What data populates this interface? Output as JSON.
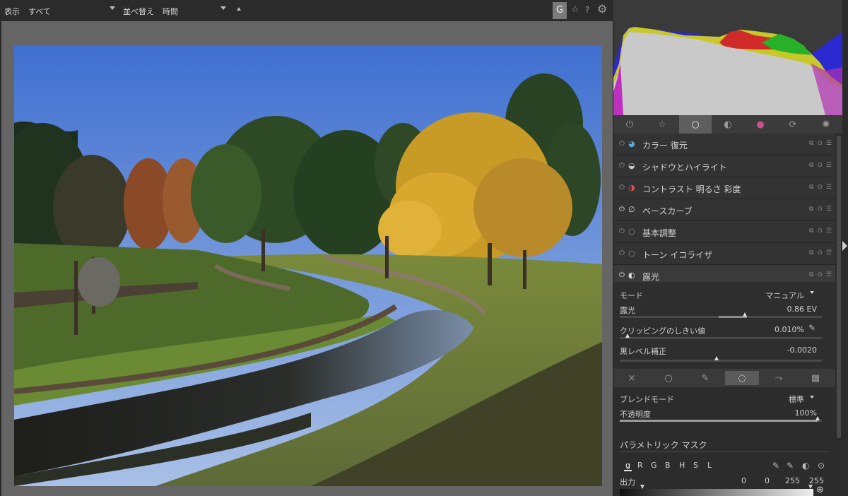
{
  "toolbar": {
    "view_label": "表示",
    "view_value": "すべて",
    "sort_label": "並べ替え",
    "sort_value": "時間",
    "grouping_btn": "G",
    "star_icon": "☆",
    "help_icon": "?",
    "gear_icon": "⚙"
  },
  "tabs": [
    {
      "name": "power",
      "glyph": "⏻"
    },
    {
      "name": "favorites",
      "glyph": "☆"
    },
    {
      "name": "basic",
      "glyph": "○"
    },
    {
      "name": "tone",
      "glyph": "◐"
    },
    {
      "name": "color",
      "glyph": "●"
    },
    {
      "name": "correct",
      "glyph": "⟳"
    },
    {
      "name": "effect",
      "glyph": "✺"
    }
  ],
  "modules": [
    {
      "label": "カラー 復元",
      "icon": "◕",
      "icon_color": "#58a8d8",
      "active": false
    },
    {
      "label": "シャドウとハイライト",
      "icon": "◒",
      "icon_color": "#c8c8c8",
      "active": false
    },
    {
      "label": "コントラスト 明るさ 彩度",
      "icon": "◑",
      "icon_color": "#e05050",
      "active": false
    },
    {
      "label": "ベースカーブ",
      "icon": "∅",
      "icon_color": "#d8d8d8",
      "active": true
    },
    {
      "label": "基本調整",
      "icon": "○",
      "icon_color": "#8a8a8a",
      "active": false
    },
    {
      "label": "トーン イコライザ",
      "icon": "○",
      "icon_color": "#8a8a8a",
      "active": false
    },
    {
      "label": "露光",
      "icon": "◐",
      "icon_color": "#e0e0e0",
      "active": true
    }
  ],
  "exposure": {
    "mode_label": "モード",
    "mode_value": "マニュアル",
    "exposure_label": "露光",
    "exposure_value": "0.86 EV",
    "exposure_level": 0.62,
    "clipping_label": "クリッピングのしきい値",
    "clipping_value": "0.010%",
    "black_label": "黒レベル補正",
    "black_value": "-0.0020",
    "black_level": 0.48
  },
  "mask_buttons": [
    "×",
    "○",
    "✎",
    "◌",
    "⤳",
    "▦"
  ],
  "blend": {
    "blend_mode_label": "ブレンドモード",
    "blend_mode_value": "標準",
    "opacity_label": "不透明度",
    "opacity_value": "100%",
    "opacity_level": 1.0,
    "parametric_title": "パラメトリック マスク",
    "channels": [
      "g",
      "R",
      "G",
      "B",
      "H",
      "S",
      "L"
    ],
    "output_label": "出力",
    "output_values": [
      "0",
      "0",
      "255",
      "255"
    ]
  }
}
